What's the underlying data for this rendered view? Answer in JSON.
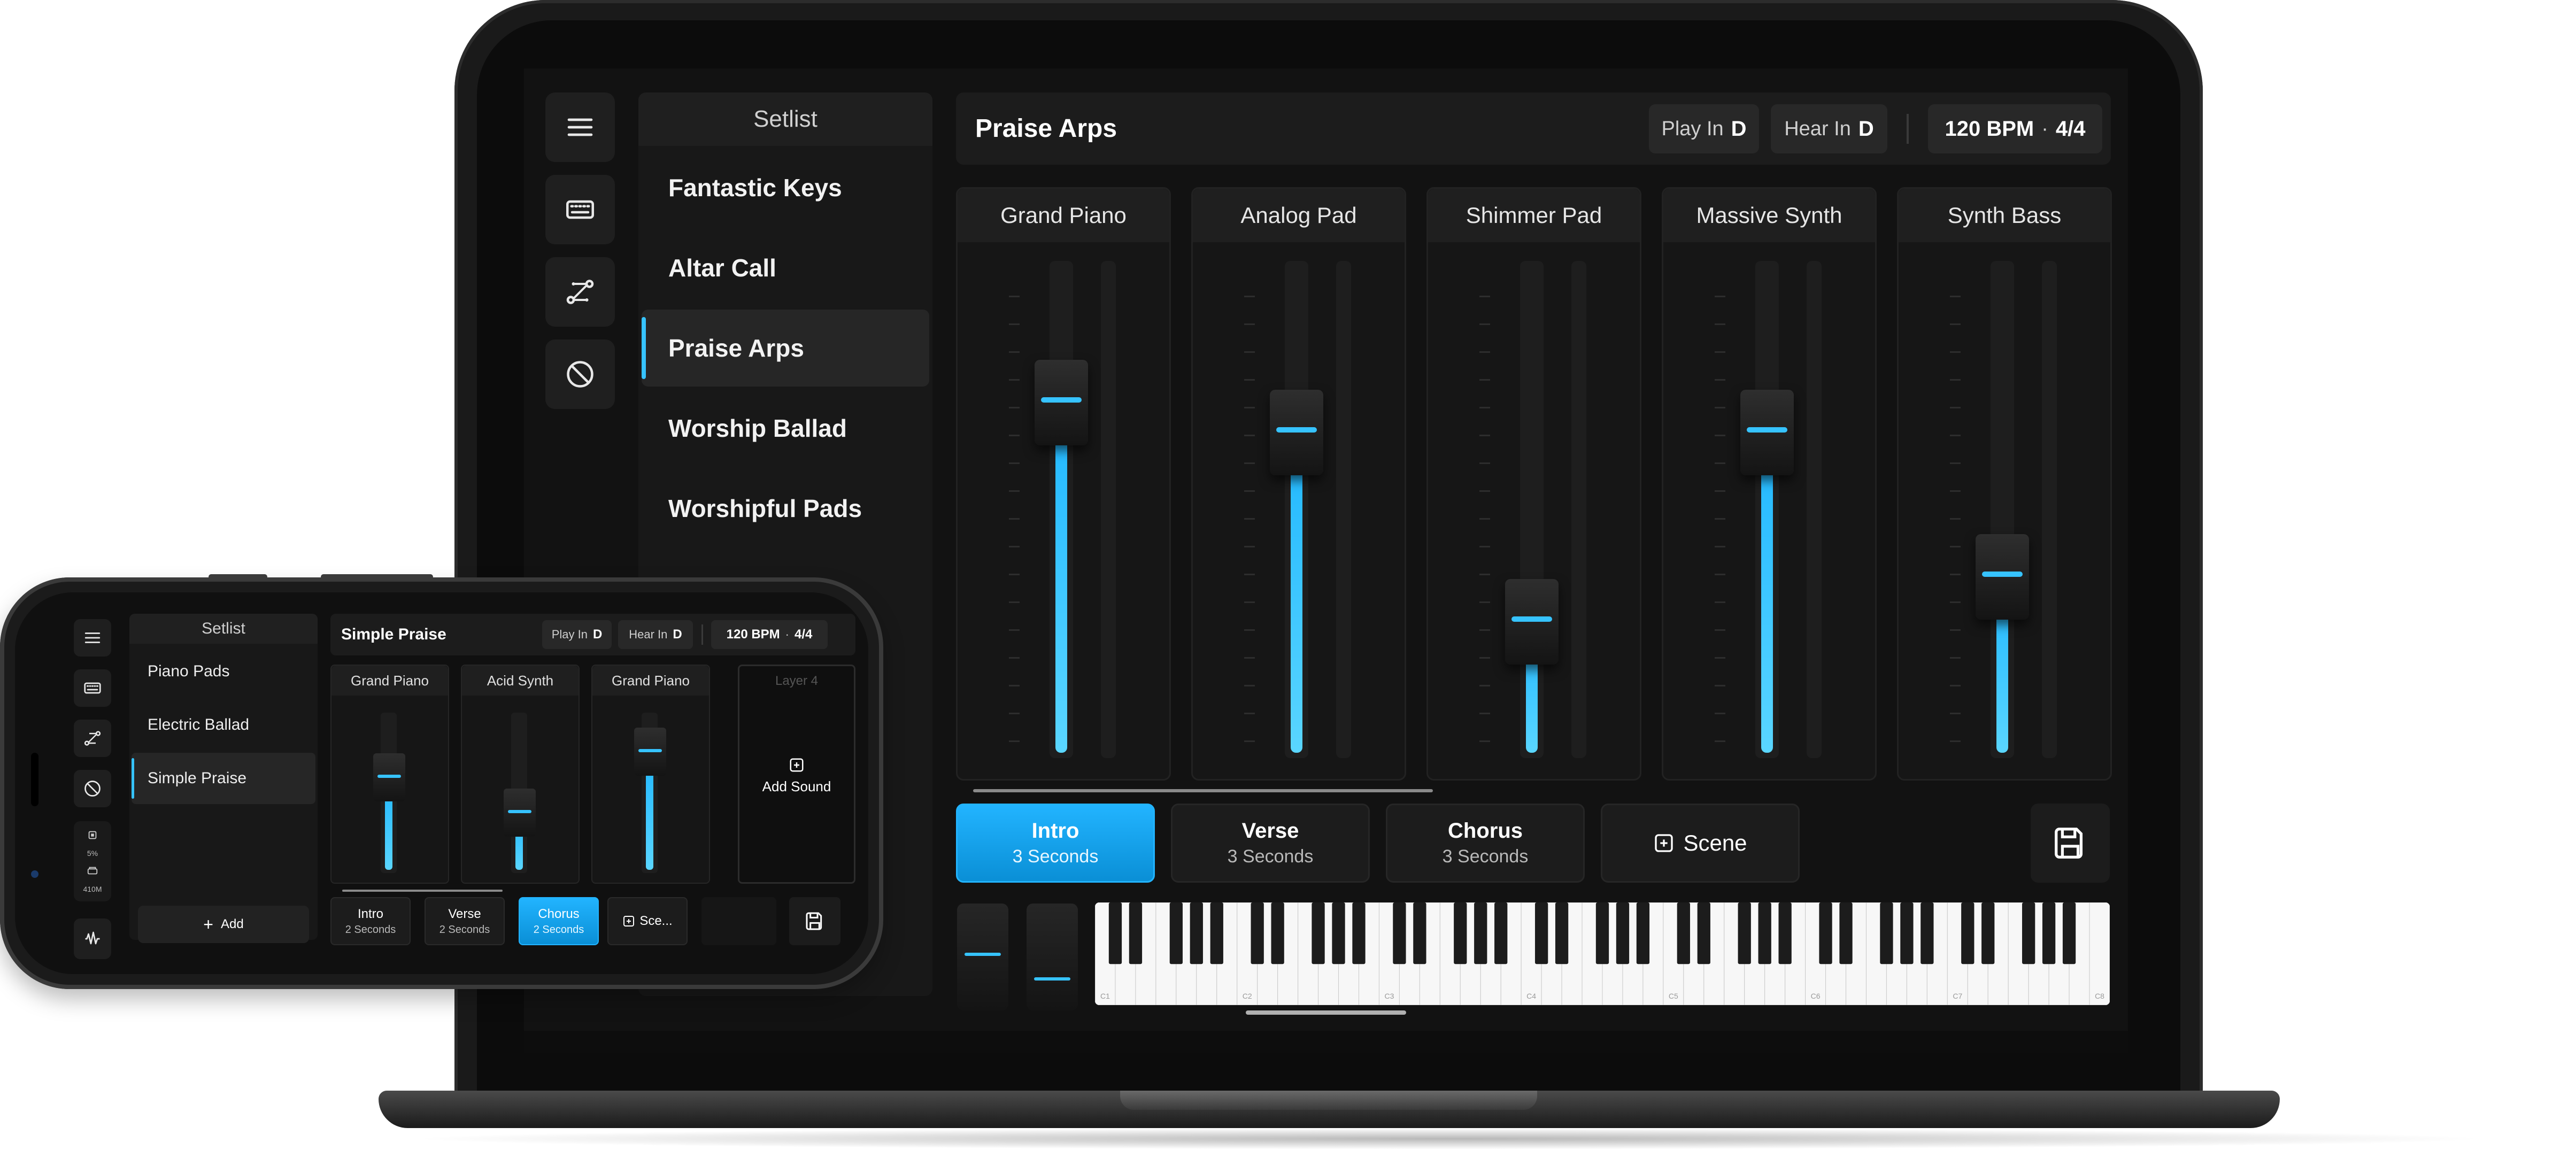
{
  "laptop": {
    "setlist": {
      "title": "Setlist",
      "items": [
        "Fantastic Keys",
        "Altar Call",
        "Praise Arps",
        "Worship Ballad",
        "Worshipful Pads"
      ],
      "active_index": 2
    },
    "header": {
      "title": "Praise Arps",
      "play_in_label": "Play In",
      "play_in_key": "D",
      "hear_in_label": "Hear In",
      "hear_in_key": "D",
      "tempo": "120 BPM",
      "tempo_sep": "·",
      "time_signature": "4/4"
    },
    "channels": [
      {
        "name": "Grand Piano",
        "level": 0.72
      },
      {
        "name": "Analog Pad",
        "level": 0.66
      },
      {
        "name": "Shimmer Pad",
        "level": 0.28
      },
      {
        "name": "Massive Synth",
        "level": 0.66
      },
      {
        "name": "Synth Bass",
        "level": 0.37
      }
    ],
    "scenes": [
      {
        "name": "Intro",
        "duration": "3 Seconds",
        "active": true
      },
      {
        "name": "Verse",
        "duration": "3 Seconds",
        "active": false
      },
      {
        "name": "Chorus",
        "duration": "3 Seconds",
        "active": false
      }
    ],
    "add_scene_label": "Scene",
    "octave_labels": [
      "C1",
      "C2",
      "C3",
      "C4",
      "C5",
      "C6",
      "C7",
      "C8"
    ]
  },
  "phone": {
    "setlist": {
      "title": "Setlist",
      "items": [
        "Piano Pads",
        "Electric Ballad",
        "Simple Praise"
      ],
      "active_index": 2
    },
    "add_label": "Add",
    "cpu_label": "5%",
    "memory_label": "410M",
    "header": {
      "title": "Simple Praise",
      "play_in_label": "Play In",
      "play_in_key": "D",
      "hear_in_label": "Hear In",
      "hear_in_key": "D",
      "tempo": "120 BPM",
      "tempo_sep": "·",
      "time_signature": "4/4"
    },
    "channels": [
      {
        "name": "Grand Piano",
        "level": 0.6
      },
      {
        "name": "Acid Synth",
        "level": 0.38
      },
      {
        "name": "Grand Piano",
        "level": 0.76
      }
    ],
    "empty_layer": {
      "name": "Layer 4",
      "action": "Add Sound"
    },
    "scenes": [
      {
        "name": "Intro",
        "duration": "2 Seconds",
        "active": false
      },
      {
        "name": "Verse",
        "duration": "2 Seconds",
        "active": false
      },
      {
        "name": "Chorus",
        "duration": "2 Seconds",
        "active": true
      }
    ],
    "add_scene_label": "Sce...",
    "accent_color": "#22b4ff"
  }
}
